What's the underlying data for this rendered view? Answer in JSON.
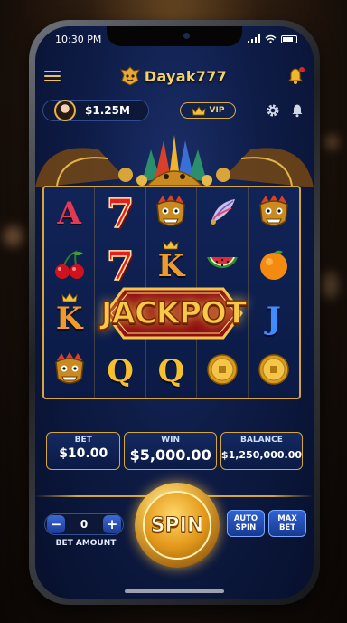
{
  "status_bar": {
    "time": "10:30 PM"
  },
  "header": {
    "title": "Dayak777"
  },
  "account": {
    "balance_short": "$1.25M",
    "vip_label": "VIP"
  },
  "reels": [
    [
      {
        "type": "letter",
        "text": "A",
        "color": "#e23a55"
      },
      {
        "type": "seven",
        "text": "7"
      },
      {
        "type": "mask"
      },
      {
        "type": "feather"
      },
      {
        "type": "mask"
      }
    ],
    [
      {
        "type": "cherry"
      },
      {
        "type": "seven",
        "text": "7"
      },
      {
        "type": "letter",
        "text": "K",
        "color": "#f09a2a"
      },
      {
        "type": "watermelon"
      },
      {
        "type": "orange"
      }
    ],
    [
      {
        "type": "letter",
        "text": "K",
        "color": "#f09a2a"
      },
      {
        "type": "blank"
      },
      {
        "type": "blank"
      },
      {
        "type": "blank"
      },
      {
        "type": "letter",
        "text": "J",
        "color": "#3f8cff"
      }
    ],
    [
      {
        "type": "mask"
      },
      {
        "type": "letter",
        "text": "Q",
        "color": "#f5c030"
      },
      {
        "type": "letter",
        "text": "Q",
        "color": "#f5c030"
      },
      {
        "type": "coin"
      },
      {
        "type": "coin"
      }
    ]
  ],
  "jackpot_banner": "JACKPOT",
  "info": {
    "bet_label": "BET",
    "bet_value": "$10.00",
    "win_label": "WIN",
    "win_value": "$5,000.00",
    "balance_label": "BALANCE",
    "balance_value": "$1,250,000.00"
  },
  "controls": {
    "minus": "−",
    "plus": "+",
    "quantity": "0",
    "bet_amount_label": "BET AMOUNT",
    "spin_label": "SPIN",
    "auto_spin_line1": "AUTO",
    "auto_spin_line2": "SPIN",
    "max_bet_line1": "MAX",
    "max_bet_line2": "BET"
  },
  "colors": {
    "gold": "#d6a63c",
    "panel": "#0b1a44",
    "accent_blue": "#2e62d4"
  }
}
